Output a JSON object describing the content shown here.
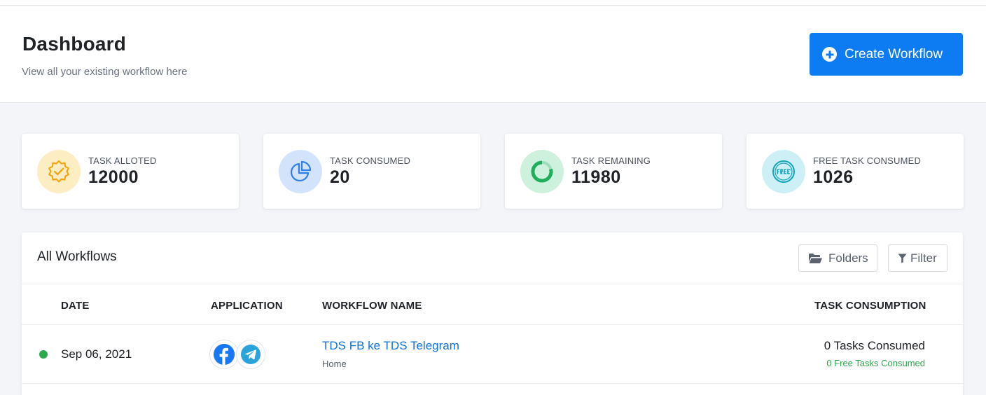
{
  "header": {
    "title": "Dashboard",
    "subtitle": "View all your existing workflow here",
    "create_button": "Create Workflow"
  },
  "stats": [
    {
      "label": "TASK ALLOTED",
      "value": "12000",
      "icon": "badge-check-icon",
      "bg": "#fdedc3",
      "color": "#f2a615"
    },
    {
      "label": "TASK CONSUMED",
      "value": "20",
      "icon": "pie-chart-icon",
      "bg": "#d3e3fb",
      "color": "#2f7fe8"
    },
    {
      "label": "TASK REMAINING",
      "value": "11980",
      "icon": "progress-ring-icon",
      "bg": "#cdf1dd",
      "color": "#1fae5b"
    },
    {
      "label": "FREE TASK CONSUMED",
      "value": "1026",
      "icon": "free-badge-icon",
      "bg": "#cdf0f6",
      "color": "#14a5bd"
    }
  ],
  "workflows": {
    "title": "All Workflows",
    "folders_button": "Folders",
    "filter_button": "Filter",
    "columns": [
      "DATE",
      "APPLICATION",
      "WORKFLOW NAME",
      "TASK CONSUMPTION"
    ],
    "rows": [
      {
        "status": "active",
        "date": "Sep 06, 2021",
        "apps": [
          "facebook-icon",
          "telegram-icon"
        ],
        "name": "TDS FB ke TDS Telegram",
        "folder": "Home",
        "consumed": "0 Tasks Consumed",
        "free_consumed": "0 Free Tasks Consumed"
      }
    ]
  },
  "colors": {
    "accent": "#0d7cf2",
    "link": "#0d72e0",
    "success": "#2aa94d",
    "background": "#f3f5f8"
  }
}
